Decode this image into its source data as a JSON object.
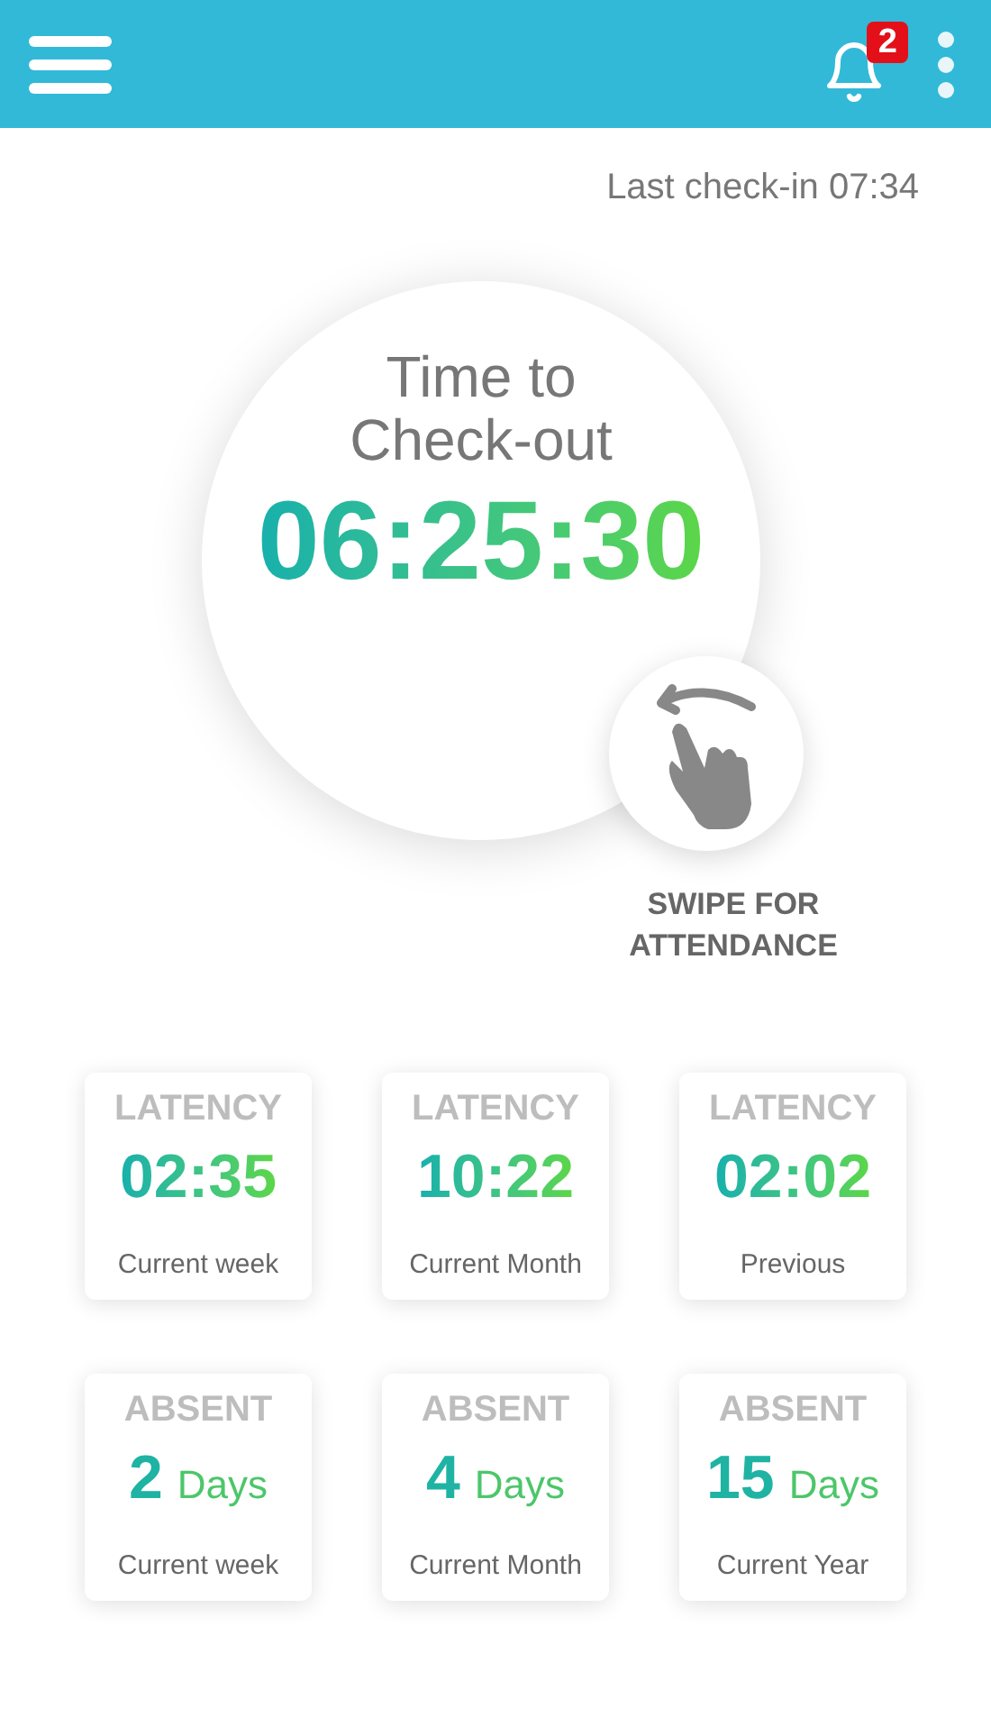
{
  "header": {
    "notification_count": "2"
  },
  "last_checkin": "Last check-in 07:34",
  "timer": {
    "title": "Time to Check-out",
    "value": "06:25:30"
  },
  "swipe": {
    "label": "SWIPE FOR ATTENDANCE"
  },
  "stats": [
    {
      "kind": "latency",
      "label": "LATENCY",
      "value": "02:35",
      "caption": "Current week"
    },
    {
      "kind": "latency",
      "label": "LATENCY",
      "value": "10:22",
      "caption": "Current Month"
    },
    {
      "kind": "latency",
      "label": "LATENCY",
      "value": "02:02",
      "caption": "Previous"
    },
    {
      "kind": "absent",
      "label": "ABSENT",
      "value": "2",
      "unit": "Days",
      "caption": "Current week"
    },
    {
      "kind": "absent",
      "label": "ABSENT",
      "value": "4",
      "unit": "Days",
      "caption": "Current Month"
    },
    {
      "kind": "absent",
      "label": "ABSENT",
      "value": "15",
      "unit": "Days",
      "caption": "Current Year"
    }
  ]
}
